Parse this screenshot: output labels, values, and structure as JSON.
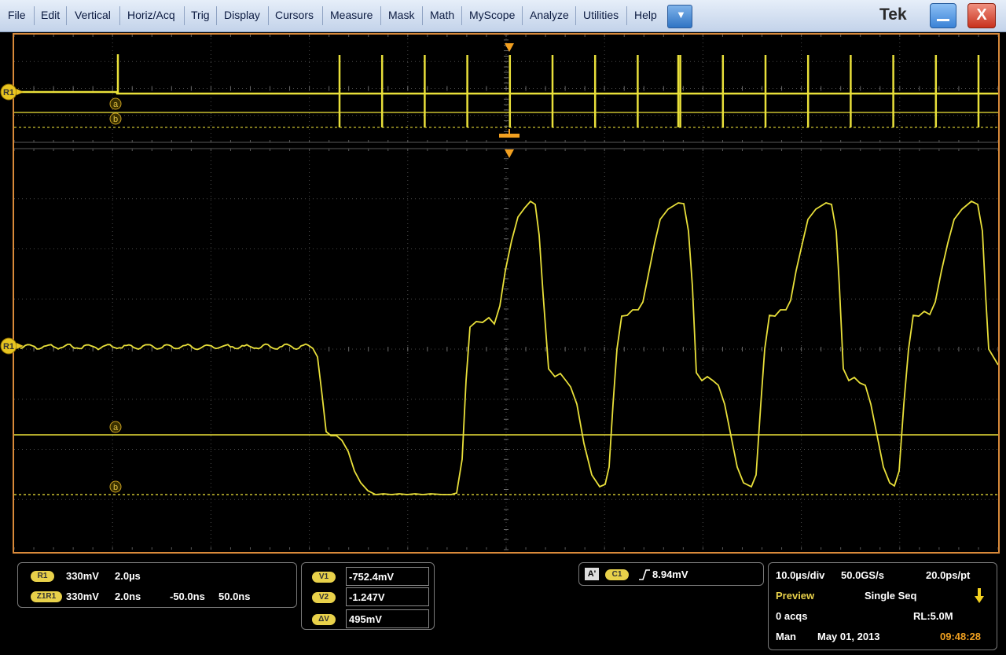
{
  "menu": {
    "items": [
      {
        "label": "File"
      },
      {
        "label": "Edit"
      },
      {
        "label": "Vertical"
      },
      {
        "label": "Horiz/Acq"
      },
      {
        "label": "Trig"
      },
      {
        "label": "Display"
      },
      {
        "label": "Cursors"
      },
      {
        "label": "Measure"
      },
      {
        "label": "Mask"
      },
      {
        "label": "Math"
      },
      {
        "label": "MyScope"
      },
      {
        "label": "Analyze"
      },
      {
        "label": "Utilities"
      },
      {
        "label": "Help"
      }
    ],
    "brand": "Tek",
    "dropdown_icon": "▼",
    "close_glyph": "X"
  },
  "overview": {
    "ref_label": "R1",
    "cursor_a": "a",
    "cursor_b": "b",
    "spike_count": 17
  },
  "zoom": {
    "ref_label": "R1",
    "cursor_a": "a",
    "cursor_b": "b"
  },
  "ref_panel": {
    "r1_badge": "R1",
    "r1_scale": "330mV",
    "r1_time": "2.0µs",
    "z1r1_badge": "Z1R1",
    "z1r1_scale": "330mV",
    "z1r1_time": "2.0ns",
    "z1r1_position": "-50.0ns",
    "z1r1_width": "50.0ns"
  },
  "cursor_panel": {
    "v1_label": "V1",
    "v1_value": "-752.4mV",
    "v2_label": "V2",
    "v2_value": "-1.247V",
    "dv_label": "ΔV",
    "dv_value": "495mV"
  },
  "trigger_panel": {
    "a_label": "A'",
    "source_label": "C1",
    "level": "8.94mV"
  },
  "acq_panel": {
    "horiz_scale": "10.0µs/div",
    "sample_rate": "50.0GS/s",
    "resolution": "20.0ps/pt",
    "mode": "Preview",
    "run_mode": "Single Seq",
    "acqs": "0 acqs",
    "record_length": "RL:5.0M",
    "trigger_mode": "Man",
    "date": "May 01, 2013",
    "time": "09:48:28"
  },
  "colors": {
    "trace": "#e9e03a",
    "frame": "#d98a3a",
    "marker": "#f2a020",
    "badge": "#e8d14a",
    "time_text": "#f0a020"
  }
}
